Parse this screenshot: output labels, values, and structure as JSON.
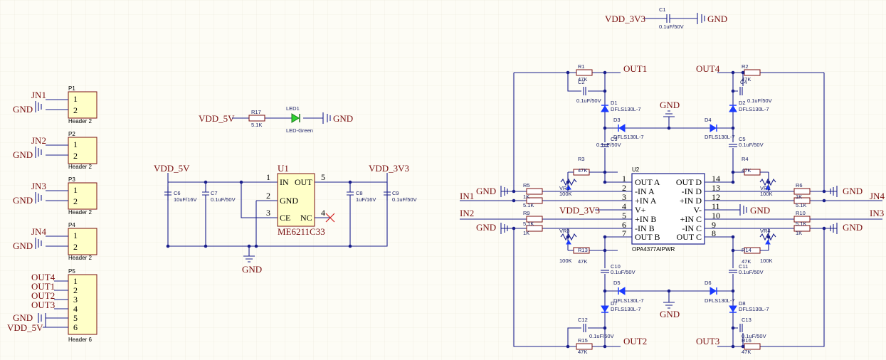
{
  "nets": {
    "vdd5": "VDD_5V",
    "vdd33": "VDD_3V3",
    "gnd": "GND",
    "jn1": "JN1",
    "jn2": "JN2",
    "jn3": "JN3",
    "jn4": "JN4",
    "in1": "IN1",
    "in2": "IN2",
    "in3": "IN3",
    "in4": "IN4",
    "out1": "OUT1",
    "out2": "OUT2",
    "out3": "OUT3",
    "out4": "OUT4"
  },
  "headers": {
    "p1": {
      "ref": "P1",
      "type": "Header 2"
    },
    "p2": {
      "ref": "P2",
      "type": "Header 2"
    },
    "p3": {
      "ref": "P3",
      "type": "Header 2"
    },
    "p4": {
      "ref": "P4",
      "type": "Header 2"
    },
    "p5": {
      "ref": "P5",
      "type": "Header 6"
    },
    "pins": [
      "1",
      "2",
      "3",
      "4",
      "5",
      "6"
    ]
  },
  "regulator": {
    "ref": "U1",
    "part": "ME6211C33",
    "pin_in": "IN",
    "pin_out": "OUT",
    "pin_gnd": "GND",
    "pin_ce": "CE",
    "pin_nc": "NC",
    "n1": "1",
    "n2": "2",
    "n3": "3",
    "n4": "4",
    "n5": "5"
  },
  "opamp": {
    "ref": "U2",
    "part": "OPA4377AIPWR",
    "left": [
      "OUT A",
      "-IN A",
      "+IN A",
      "V+",
      "+IN B",
      "-IN B",
      "OUT B"
    ],
    "right": [
      "OUT D",
      "-IN D",
      "+IN D",
      "V-",
      "+IN C",
      "-IN C",
      "OUT C"
    ],
    "left_nums": [
      "1",
      "2",
      "3",
      "4",
      "5",
      "6",
      "7"
    ],
    "right_nums": [
      "14",
      "13",
      "12",
      "11",
      "10",
      "9",
      "8"
    ]
  },
  "parts": {
    "c1": "C1",
    "c1v": "0.1uF/50V",
    "c2": "C2",
    "c2v": "0.1uF/50V",
    "c3": "C3",
    "c3v": "0.1uF/50V",
    "c4": "C4",
    "c4v": "0.1uF/50V",
    "c5": "C5",
    "c5v": "0.1uF/50V",
    "c6": "C6",
    "c6v": "10uF/16V",
    "c7": "C7",
    "c7v": "0.1uF/50V",
    "c8": "C8",
    "c8v": "1uF/16V",
    "c9": "C9",
    "c9v": "0.1uF/50V",
    "c10": "C10",
    "c10v": "0.1uF/50V",
    "c11": "C11",
    "c11v": "0.1uF/50V",
    "c12": "C12",
    "c12v": "0.1uF/50V",
    "c13": "C13",
    "c13v": "0.1uF/50V",
    "r1": "R1",
    "r1v": "47K",
    "r2": "R2",
    "r2v": "47K",
    "r3": "R3",
    "r3v": "47K",
    "r4": "R4",
    "r4v": "47K",
    "r5": "R5",
    "r5v": "5.1K",
    "r6": "R6",
    "r6v": "5.1K",
    "r7v": "1K",
    "r8v": "1K",
    "r9": "R9",
    "r9v": "5.1K",
    "r10": "R10",
    "r10v": "5.1K",
    "r11v": "1K",
    "r12v": "1K",
    "r13": "R13",
    "r13v": "47K",
    "r14": "R14",
    "r14v": "47K",
    "r15": "R15",
    "r15v": "47K",
    "r16": "R16",
    "r16v": "47K",
    "r17": "R17",
    "r17v": "5.1K",
    "vr1": "VR1",
    "vr1v": "100K",
    "vr2": "VR2",
    "vr2v": "100K",
    "vr3": "VR3",
    "vr3v": "100K",
    "vr4": "VR4",
    "vr4v": "100K",
    "d1": "D1",
    "d2": "D2",
    "d3": "D3",
    "d4": "D4",
    "d5": "D5",
    "d6": "D6",
    "d7": "D7",
    "d8": "D8",
    "dv": "DFLS130L-7",
    "led1": "LED1",
    "ledv": "LED-Green"
  },
  "colors": {
    "wire": "#1a1f8c",
    "sheet": "#fdfcf5",
    "net_label": "#7a1010",
    "diode": "#1b3aff",
    "led": "#2fd12f"
  }
}
